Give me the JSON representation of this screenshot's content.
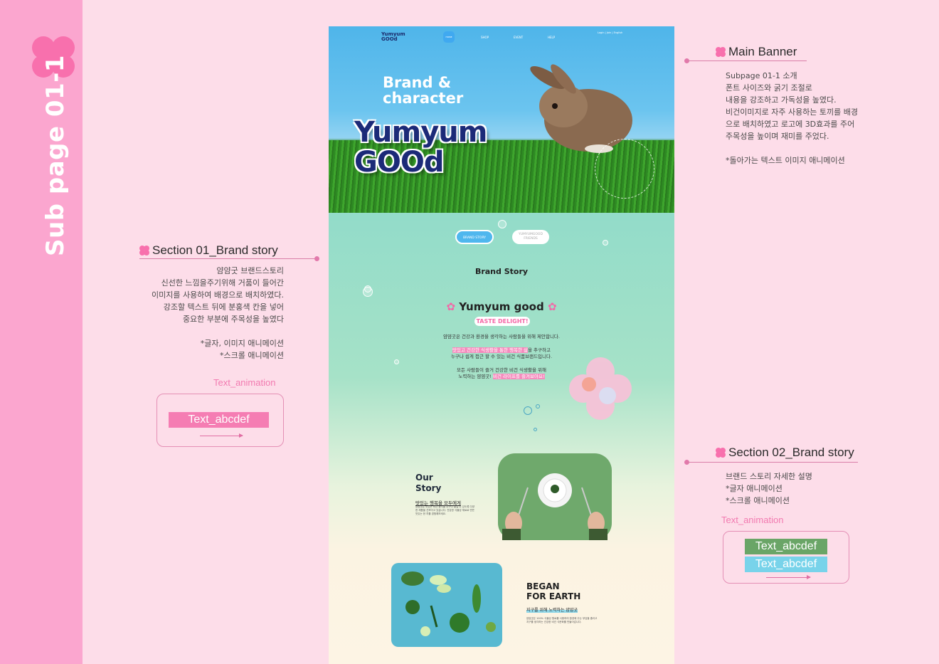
{
  "side_title": "Sub page 01-1",
  "colors": {
    "pink_strip": "#fba6cf",
    "accent_pink": "#f870ad",
    "bg": "#fddde9"
  },
  "main_banner": {
    "title": "Main Banner",
    "body": "Subpage 01-1 소개\n폰트 사이즈와 굵기 조절로\n내용을 강조하고 가독성을 높였다.\n비건이미지로 자주 사용하는 토끼를 배경\n으로 배치하였고 로고에 3D효과를 주어\n주목성을 높이며 재미를 주었다.\n\n*돌아가는 텍스트 이미지 애니메이션"
  },
  "section01": {
    "title": "Section 01_Brand story",
    "body": "얌얌굿 브랜드스토리\n신선한 느낌을주기위해 거품이 들어간\n이미지를 사용하여 배경으로 배치하였다.\n강조할 텍스트 뒤에 분홍색 칸을 넣어\n중요한 부분에 주목성을 높였다\n\n*글자, 이미지 애니메이션\n*스크롤 애니메이션",
    "anim_label": "Text_animation",
    "chip": "Text_abcdef"
  },
  "section02": {
    "title": "Section 02_Brand story",
    "body": "브랜드 스토리 자세한 설명\n*글자 애니메이션\n*스크롤 애니메이션",
    "anim_label": "Text_animation",
    "chips": [
      "Text_abcdef",
      "Text_abcdef"
    ]
  },
  "page": {
    "nav": {
      "logo": "Yumyum\nGOOd",
      "home": "HOME",
      "items": [
        "SHOP",
        "EVENT",
        "HELP"
      ],
      "util": "Login | Join | English"
    },
    "hero": {
      "heading": "Brand &\ncharacter",
      "logo": "Yumyum\nGOOd"
    },
    "tabs": [
      "BRAND STORY",
      "YUMYUMGOOD FRIENDS"
    ],
    "brand_story_title": "Brand Story",
    "yumyum_good": "Yumyum good",
    "taste": "TASTE DELIGHT!",
    "intro_1": "얌얌굿은 건강과 환경을 생각하는 사람들을 위해 제안합니다.",
    "intro_2_hl": "맛있고 건강한 식생활을 통한 행복한 삶",
    "intro_2_rest": "을 추구하고",
    "intro_3": "누구나 쉽게 접근 할 수 있는 비건 식품브랜드입니다.",
    "intro_4": "모든 사람들이 즐거 건강한 비건 식생활을 위해",
    "intro_5_a": "노력하는 얌얌굿! ",
    "intro_5_hl": "비건 라이프를 즐겨보아요!",
    "our_story": "Our\nStory",
    "our_story_sub": "맛있는 행복을 모두에게",
    "our_story_body": "얌얌굿은 맛있는 비건 음식을 누구나 즐길 수 있도록 다양한 제품을 선보이고 있습니다. 건강한 식물성 재료로 만든 맛있는 한 끼를 경험해보세요.",
    "bfe_title": "BEGAN\nFOR EARTH",
    "bfe_sub": "지구를 위해 노력하는 얌얌굿",
    "bfe_body": "얌얌굿은 100% 식물성 원료를 사용하여 환경에 주는 부담을 줄이고 지구를 생각하는 건강한 비건 식문화를 만들어갑니다."
  }
}
